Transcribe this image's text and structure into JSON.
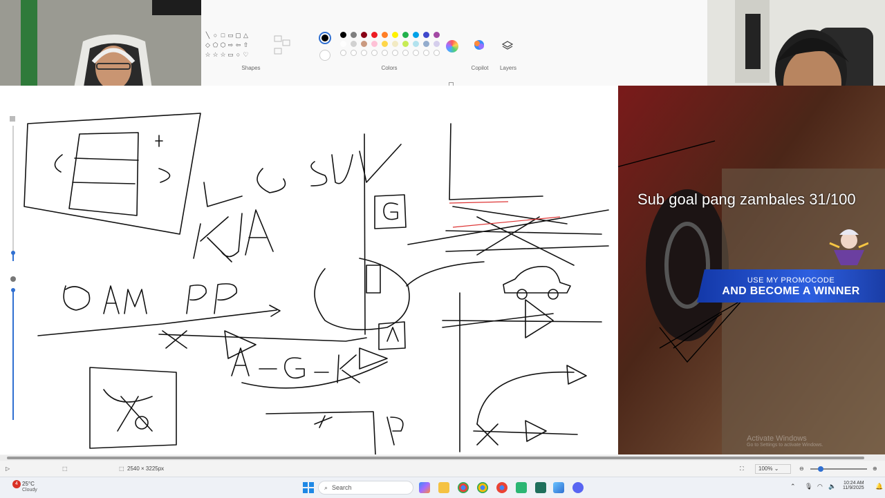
{
  "ribbon": {
    "groups": [
      {
        "label": "Shapes"
      },
      {
        "label": "Colors"
      },
      {
        "label": "Copilot"
      },
      {
        "label": "Layers"
      }
    ],
    "shape_glyphs": [
      "╲",
      "○",
      "□",
      "▭",
      "▢",
      "△",
      "",
      "◇",
      "⬠",
      "⬡",
      "⇨",
      "⇦",
      "⇧",
      "",
      "☆",
      "☆",
      "☆",
      "▭",
      "○",
      "♡",
      ""
    ],
    "color_row1": [
      "#000000",
      "#7f7f7f",
      "#880015",
      "#ed1c24",
      "#ff7f27",
      "#fff200",
      "#22b14c",
      "#00a2e8",
      "#3f48cc",
      "#a349a4"
    ],
    "color_row2": [
      "#ffffff",
      "#c3c3c3",
      "#b97a57",
      "#ffaec9",
      "#ffc90e",
      "#efe4b0",
      "#b5e61d",
      "#99d9ea",
      "#7092be",
      "#c8bfe7"
    ],
    "active_color": "#000000",
    "accent": "#2f6fd1"
  },
  "drawing": {
    "strokes": [
      "J",
      "H",
      "K",
      "G",
      "SU",
      "KJA",
      "G",
      "A",
      "G",
      "AM",
      "PP",
      "A",
      "G",
      "K",
      "A",
      "P"
    ]
  },
  "stream": {
    "sub_goal": "Sub goal pang zambales 31/100",
    "promo_line1": "USE MY PROMOCODE",
    "promo_line2": "AND BECOME A WINNER",
    "watermark_title": "Activate Windows",
    "watermark_sub": "Go to Settings to activate Windows."
  },
  "status": {
    "canvas_size": "2540 × 3225px",
    "zoom": "100%"
  },
  "taskbar": {
    "weather_temp": "25°C",
    "weather_text": "Cloudy",
    "weather_badge": "4",
    "search_placeholder": "Search",
    "time": "10:24 AM",
    "date": "11/9/2025"
  }
}
